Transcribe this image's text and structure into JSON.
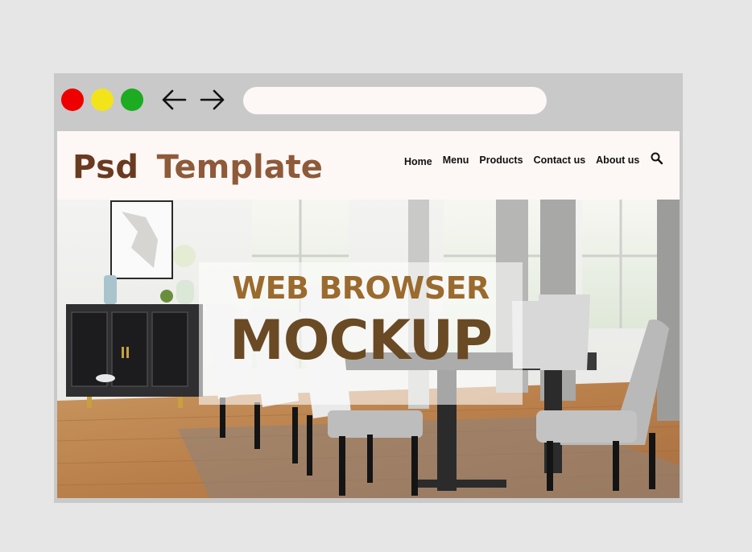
{
  "window": {
    "controls": {
      "close_color": "#ee0000",
      "minimize_color": "#f3e41a",
      "maximize_color": "#1cab21"
    },
    "back_icon": "arrow-left-icon",
    "forward_icon": "arrow-right-icon",
    "address_bar": {
      "value": "",
      "placeholder": ""
    }
  },
  "site": {
    "logo": {
      "word1": "Psd",
      "word2": "Template"
    },
    "nav": {
      "items": [
        {
          "label": "Home"
        },
        {
          "label": "Menu"
        },
        {
          "label": "Products"
        },
        {
          "label": "Contact us"
        },
        {
          "label": "About us"
        }
      ],
      "search_icon": "search-icon"
    },
    "hero": {
      "headline1": "WEB BROWSER",
      "headline2": "MOCKUP",
      "image": "dining-room-photo"
    }
  },
  "colors": {
    "page_background": "#e6e6e6",
    "browser_chrome": "#c9c9c9",
    "logo_primary": "#6a3a20",
    "logo_secondary": "#8e5a3a",
    "headline_primary": "#9a6a2e",
    "headline_secondary": "#6a4a24"
  }
}
